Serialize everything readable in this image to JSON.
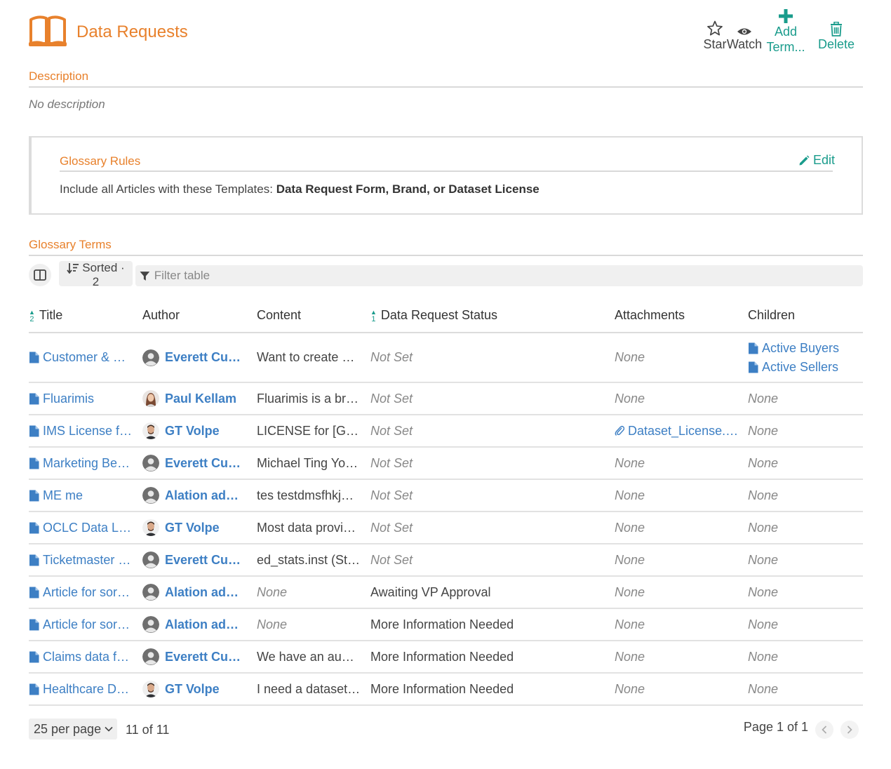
{
  "header": {
    "title": "Data Requests",
    "actions": {
      "star": "Star",
      "watch": "Watch",
      "add_line1": "Add",
      "add_line2": "Term...",
      "delete": "Delete"
    }
  },
  "description": {
    "heading": "Description",
    "text": "No description"
  },
  "glossary_rules": {
    "heading": "Glossary Rules",
    "edit_label": "Edit",
    "text_prefix": "Include all Articles with these Templates: ",
    "templates": "Data Request Form, Brand, or Dataset License"
  },
  "glossary_terms": {
    "heading": "Glossary Terms",
    "sorted_label": "Sorted ·",
    "sorted_count": "2",
    "filter_placeholder": "Filter table",
    "columns": {
      "title": "Title",
      "title_sort": "2",
      "author": "Author",
      "content": "Content",
      "status": "Data Request Status",
      "status_sort": "1",
      "attachments": "Attachments",
      "children": "Children"
    },
    "rows": [
      {
        "title": "Customer & …",
        "author": "Everett Cu…",
        "avatar": "generic",
        "content": "Want to create …",
        "status": "Not Set",
        "attachments": "None",
        "children": [
          "Active Buyers",
          "Active Sellers"
        ]
      },
      {
        "title": "Fluarimis",
        "author": "Paul Kellam",
        "avatar": "woman",
        "content": "Fluarimis is a br…",
        "status": "Not Set",
        "attachments": "None",
        "children": "None"
      },
      {
        "title": "IMS License f…",
        "author": "GT Volpe",
        "avatar": "man",
        "content": "LICENSE for  [G…",
        "status": "Not Set",
        "attachments": "Dataset_License.…",
        "children": "None"
      },
      {
        "title": "Marketing Be…",
        "author": "Everett Cu…",
        "avatar": "generic",
        "content": "Michael Ting Yo…",
        "status": "Not Set",
        "attachments": "None",
        "children": "None"
      },
      {
        "title": "ME me",
        "author": "Alation ad…",
        "avatar": "generic",
        "content": "tes testdmsfhkj…",
        "status": "Not Set",
        "attachments": "None",
        "children": "None"
      },
      {
        "title": "OCLC Data L…",
        "author": "GT Volpe",
        "avatar": "man",
        "content": "Most data provi…",
        "status": "Not Set",
        "attachments": "None",
        "children": "None"
      },
      {
        "title": "Ticketmaster …",
        "author": "Everett Cu…",
        "avatar": "generic",
        "content": "ed_stats.inst (St…",
        "status": "Not Set",
        "attachments": "None",
        "children": "None"
      },
      {
        "title": "Article for sor…",
        "author": "Alation ad…",
        "avatar": "generic",
        "content": "None",
        "status": "Awaiting VP Approval",
        "attachments": "None",
        "children": "None"
      },
      {
        "title": "Article for sor…",
        "author": "Alation ad…",
        "avatar": "generic",
        "content": "None",
        "status": "More Information Needed",
        "attachments": "None",
        "children": "None"
      },
      {
        "title": "Claims data f…",
        "author": "Everett Cu…",
        "avatar": "generic",
        "content": "We have an aud…",
        "status": "More Information Needed",
        "attachments": "None",
        "children": "None"
      },
      {
        "title": "Healthcare D…",
        "author": "GT Volpe",
        "avatar": "man",
        "content": "I need a dataset…",
        "status": "More Information Needed",
        "attachments": "None",
        "children": "None"
      }
    ]
  },
  "pagination": {
    "per_page": "25 per page",
    "count": "11 of 11",
    "page": "Page 1 of 1"
  },
  "colors": {
    "accent_orange": "#e8812c",
    "accent_teal": "#1a9c8c",
    "link_blue": "#3d7fc4"
  }
}
